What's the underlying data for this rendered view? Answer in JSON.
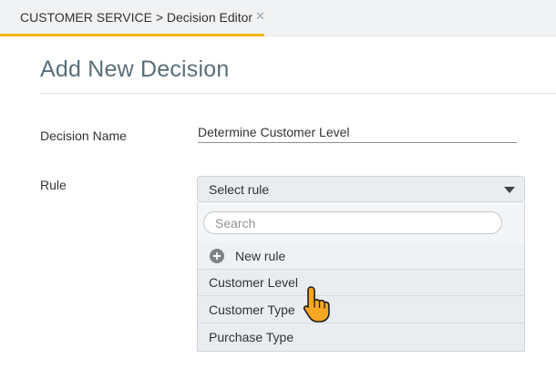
{
  "tab": {
    "label": "CUSTOMER SERVICE > Decision Editor",
    "close_symbol": "✕"
  },
  "page": {
    "title": "Add New Decision"
  },
  "form": {
    "decision_name_label": "Decision Name",
    "decision_name_value": "Determine Customer Level",
    "rule_label": "Rule",
    "rule_selected": "Select rule"
  },
  "dropdown": {
    "search_placeholder": "Search",
    "new_rule_label": "New rule",
    "options": [
      "Customer Level",
      "Customer Type",
      "Purchase Type"
    ]
  },
  "icons": {
    "close": "close-icon",
    "caret": "chevron-down-icon",
    "add": "plus-circle-icon",
    "cursor": "hand-pointer-icon"
  },
  "colors": {
    "tab_accent": "#f5b400",
    "title": "#5a6e7a",
    "cursor_fill": "#f5a623"
  }
}
